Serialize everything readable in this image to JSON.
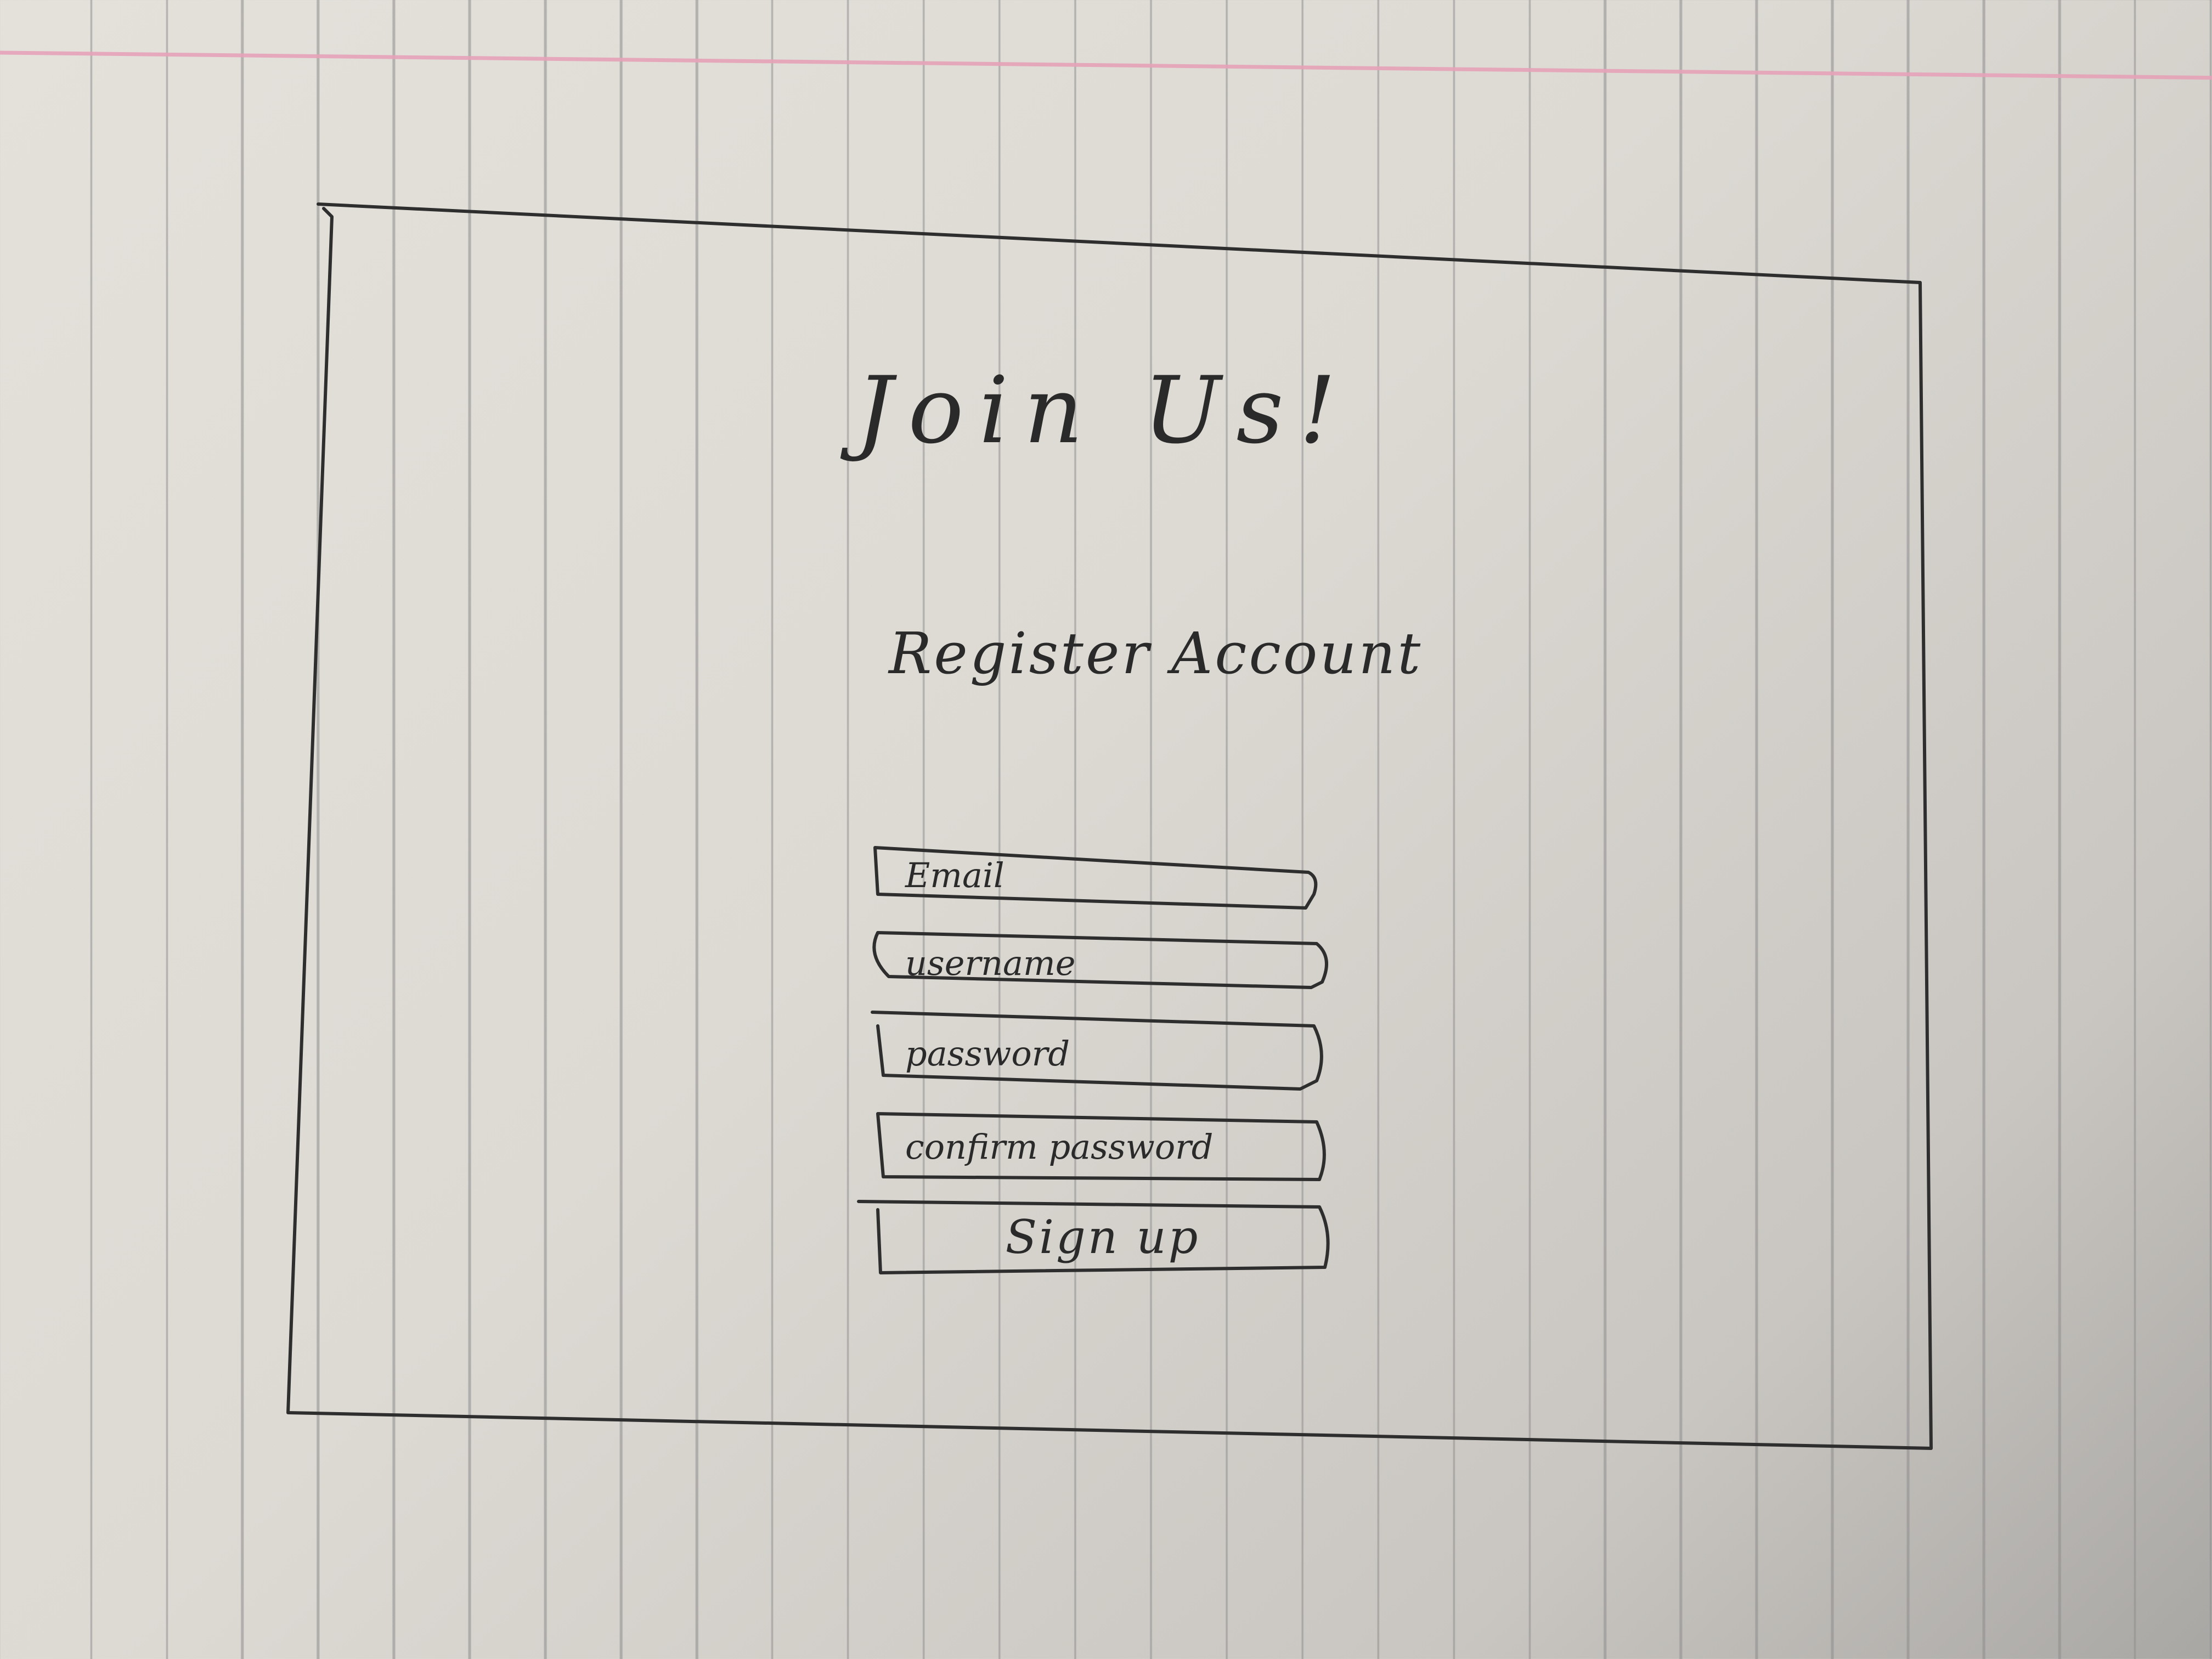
{
  "sketch": {
    "title": "Join Us!",
    "subtitle": "Register Account",
    "form": {
      "email_placeholder": "Email",
      "username_placeholder": "username",
      "password_placeholder": "password",
      "confirm_password_placeholder": "confirm password",
      "signup_label": "Sign up"
    }
  },
  "colors": {
    "ink": "#2e2e2e",
    "paper": "#e2dfd9",
    "margin_line": "#e6a2b8"
  }
}
